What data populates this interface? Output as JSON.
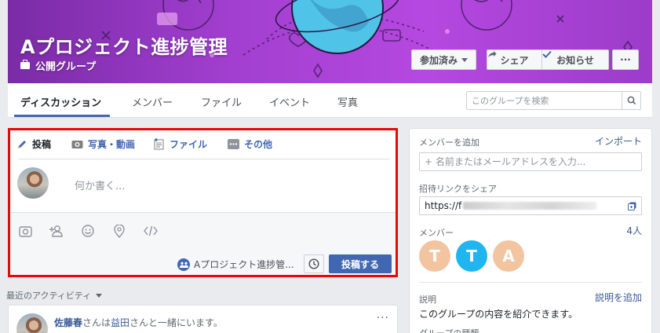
{
  "group": {
    "title": "Aプロジェクト進捗管理",
    "privacy": "公開グループ",
    "joined_label": "参加済み",
    "share_label": "シェア",
    "notify_label": "お知らせ",
    "more_label": "···"
  },
  "tabs": [
    {
      "label": "ディスカッション"
    },
    {
      "label": "メンバー"
    },
    {
      "label": "ファイル"
    },
    {
      "label": "イベント"
    },
    {
      "label": "写真"
    }
  ],
  "search": {
    "placeholder": "このグループを検索"
  },
  "composer": {
    "tabs": [
      {
        "label": "投稿",
        "icon": "pencil-icon"
      },
      {
        "label": "写真・動画",
        "icon": "camera-icon"
      },
      {
        "label": "ファイル",
        "icon": "file-icon"
      },
      {
        "label": "その他",
        "icon": "more-icon"
      }
    ],
    "placeholder": "何か書く...",
    "audience": "Aプロジェクト進捗管...",
    "post_label": "投稿する",
    "tools": [
      "photo-icon",
      "tag-person-icon",
      "emoji-icon",
      "location-icon",
      "code-icon"
    ]
  },
  "activity": {
    "header": "最近のアクティビティ",
    "item": {
      "user": "佐藤春",
      "mid1": "さんは",
      "friend": "益田",
      "mid2": "さんと一緒にいます。",
      "more": "···"
    }
  },
  "sidebar": {
    "add_member_label": "メンバーを追加",
    "import_label": "インポート",
    "add_member_placeholder": "+ 名前またはメールアドレスを入力...",
    "invite_link_label": "招待リンクをシェア",
    "invite_link_value": "https://f",
    "members_label": "メンバー",
    "members_count": "4人",
    "members": [
      {
        "initial": "T",
        "color": "#f2c4a0"
      },
      {
        "initial": "T",
        "color": "#1fb5ef"
      },
      {
        "initial": "A",
        "color": "#f2c4a0"
      }
    ],
    "description_label": "説明",
    "description_link": "説明を追加",
    "description_text": "このグループの内容を紹介できます。",
    "group_type_label": "グループの種類"
  },
  "colors": {
    "accent": "#4267b2",
    "highlight_border": "#e8070a",
    "cover": "#a23fd0"
  }
}
